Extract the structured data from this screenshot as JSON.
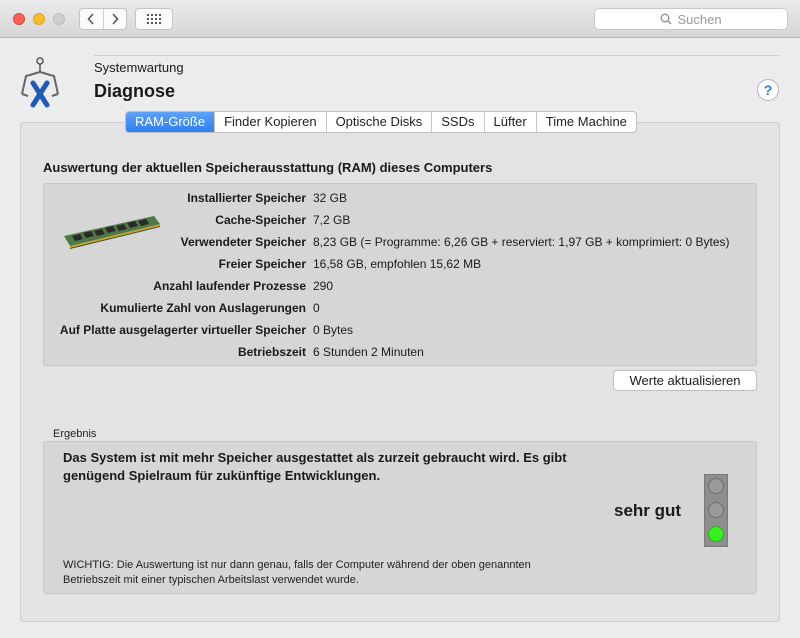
{
  "window": {
    "nav_back_icon": "chevron-left-icon",
    "nav_forward_icon": "chevron-right-icon",
    "grid_icon": "grid-icon",
    "search": {
      "placeholder": "Suchen"
    }
  },
  "header": {
    "subtitle": "Systemwartung",
    "title": "Diagnose",
    "help_label": "?"
  },
  "tabs": [
    {
      "label": "RAM-Größe",
      "active": true
    },
    {
      "label": "Finder Kopieren",
      "active": false
    },
    {
      "label": "Optische Disks",
      "active": false
    },
    {
      "label": "SSDs",
      "active": false
    },
    {
      "label": "Lüfter",
      "active": false
    },
    {
      "label": "Time Machine",
      "active": false
    }
  ],
  "main": {
    "section_title": "Auswertung der aktuellen Speicherausstattung (RAM) dieses Computers",
    "rows": [
      {
        "label": "Installierter Speicher",
        "value": "32 GB"
      },
      {
        "label": "Cache-Speicher",
        "value": "7,2 GB"
      },
      {
        "label": "Verwendeter Speicher",
        "value": "8,23 GB (= Programme: 6,26 GB + reserviert: 1,97 GB + komprimiert: 0 Bytes)"
      },
      {
        "label": "Freier Speicher",
        "value": "16,58 GB, empfohlen 15,62 MB"
      },
      {
        "label": "Anzahl laufender Prozesse",
        "value": "290"
      },
      {
        "label": "Kumulierte Zahl von Auslagerungen",
        "value": "0"
      },
      {
        "label": "Auf Platte ausgelagerter virtueller Speicher",
        "value": "0 Bytes"
      },
      {
        "label": "Betriebszeit",
        "value": "6 Stunden 2 Minuten"
      }
    ],
    "refresh_label": "Werte aktualisieren"
  },
  "result": {
    "label": "Ergebnis",
    "text": "Das System ist mit mehr Speicher ausgestattet als zurzeit gebraucht wird. Es gibt genügend Spielraum für zukünftige Entwicklungen.",
    "rating": "sehr gut",
    "traffic_light_active": "green",
    "note": "WICHTIG: Die Auswertung ist nur dann genau, falls der Computer während der oben genannten Betriebszeit mit einer typischen Arbeitslast verwendet wurde."
  },
  "colors": {
    "accent": "#2f7ff0",
    "light_on": "#35f01e",
    "light_off": "#9a9a9a"
  }
}
